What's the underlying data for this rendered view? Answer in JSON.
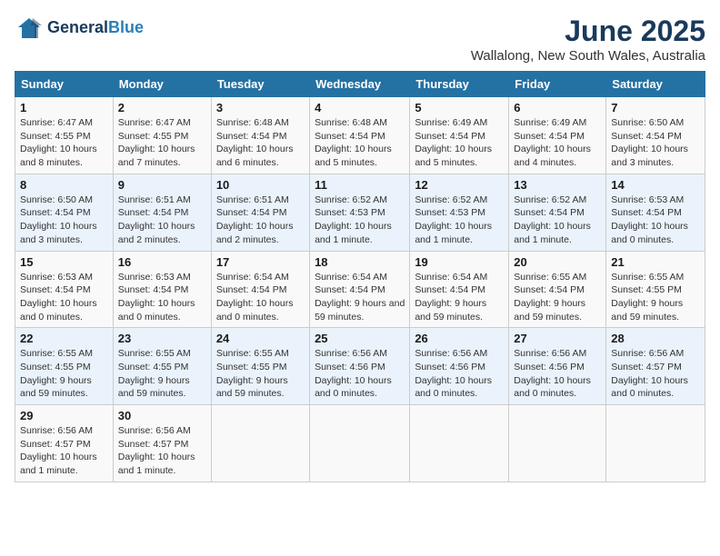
{
  "header": {
    "logo_text_general": "General",
    "logo_text_blue": "Blue",
    "title": "June 2025",
    "subtitle": "Wallalong, New South Wales, Australia"
  },
  "calendar": {
    "headers": [
      "Sunday",
      "Monday",
      "Tuesday",
      "Wednesday",
      "Thursday",
      "Friday",
      "Saturday"
    ],
    "weeks": [
      [
        {
          "day": "",
          "detail": ""
        },
        {
          "day": "2",
          "detail": "Sunrise: 6:47 AM\nSunset: 4:55 PM\nDaylight: 10 hours and 7 minutes."
        },
        {
          "day": "3",
          "detail": "Sunrise: 6:48 AM\nSunset: 4:54 PM\nDaylight: 10 hours and 6 minutes."
        },
        {
          "day": "4",
          "detail": "Sunrise: 6:48 AM\nSunset: 4:54 PM\nDaylight: 10 hours and 5 minutes."
        },
        {
          "day": "5",
          "detail": "Sunrise: 6:49 AM\nSunset: 4:54 PM\nDaylight: 10 hours and 5 minutes."
        },
        {
          "day": "6",
          "detail": "Sunrise: 6:49 AM\nSunset: 4:54 PM\nDaylight: 10 hours and 4 minutes."
        },
        {
          "day": "7",
          "detail": "Sunrise: 6:50 AM\nSunset: 4:54 PM\nDaylight: 10 hours and 3 minutes."
        }
      ],
      [
        {
          "day": "1",
          "detail": "Sunrise: 6:47 AM\nSunset: 4:55 PM\nDaylight: 10 hours and 8 minutes."
        },
        {
          "day": "8",
          "detail": ""
        },
        {
          "day": "",
          "detail": ""
        },
        {
          "day": "",
          "detail": ""
        },
        {
          "day": "",
          "detail": ""
        },
        {
          "day": "",
          "detail": ""
        },
        {
          "day": "",
          "detail": ""
        }
      ],
      [
        {
          "day": "8",
          "detail": "Sunrise: 6:50 AM\nSunset: 4:54 PM\nDaylight: 10 hours and 3 minutes."
        },
        {
          "day": "9",
          "detail": "Sunrise: 6:51 AM\nSunset: 4:54 PM\nDaylight: 10 hours and 2 minutes."
        },
        {
          "day": "10",
          "detail": "Sunrise: 6:51 AM\nSunset: 4:54 PM\nDaylight: 10 hours and 2 minutes."
        },
        {
          "day": "11",
          "detail": "Sunrise: 6:52 AM\nSunset: 4:53 PM\nDaylight: 10 hours and 1 minute."
        },
        {
          "day": "12",
          "detail": "Sunrise: 6:52 AM\nSunset: 4:53 PM\nDaylight: 10 hours and 1 minute."
        },
        {
          "day": "13",
          "detail": "Sunrise: 6:52 AM\nSunset: 4:54 PM\nDaylight: 10 hours and 1 minute."
        },
        {
          "day": "14",
          "detail": "Sunrise: 6:53 AM\nSunset: 4:54 PM\nDaylight: 10 hours and 0 minutes."
        }
      ],
      [
        {
          "day": "15",
          "detail": "Sunrise: 6:53 AM\nSunset: 4:54 PM\nDaylight: 10 hours and 0 minutes."
        },
        {
          "day": "16",
          "detail": "Sunrise: 6:53 AM\nSunset: 4:54 PM\nDaylight: 10 hours and 0 minutes."
        },
        {
          "day": "17",
          "detail": "Sunrise: 6:54 AM\nSunset: 4:54 PM\nDaylight: 10 hours and 0 minutes."
        },
        {
          "day": "18",
          "detail": "Sunrise: 6:54 AM\nSunset: 4:54 PM\nDaylight: 9 hours and 59 minutes."
        },
        {
          "day": "19",
          "detail": "Sunrise: 6:54 AM\nSunset: 4:54 PM\nDaylight: 9 hours and 59 minutes."
        },
        {
          "day": "20",
          "detail": "Sunrise: 6:55 AM\nSunset: 4:54 PM\nDaylight: 9 hours and 59 minutes."
        },
        {
          "day": "21",
          "detail": "Sunrise: 6:55 AM\nSunset: 4:55 PM\nDaylight: 9 hours and 59 minutes."
        }
      ],
      [
        {
          "day": "22",
          "detail": "Sunrise: 6:55 AM\nSunset: 4:55 PM\nDaylight: 9 hours and 59 minutes."
        },
        {
          "day": "23",
          "detail": "Sunrise: 6:55 AM\nSunset: 4:55 PM\nDaylight: 9 hours and 59 minutes."
        },
        {
          "day": "24",
          "detail": "Sunrise: 6:55 AM\nSunset: 4:55 PM\nDaylight: 9 hours and 59 minutes."
        },
        {
          "day": "25",
          "detail": "Sunrise: 6:56 AM\nSunset: 4:56 PM\nDaylight: 10 hours and 0 minutes."
        },
        {
          "day": "26",
          "detail": "Sunrise: 6:56 AM\nSunset: 4:56 PM\nDaylight: 10 hours and 0 minutes."
        },
        {
          "day": "27",
          "detail": "Sunrise: 6:56 AM\nSunset: 4:56 PM\nDaylight: 10 hours and 0 minutes."
        },
        {
          "day": "28",
          "detail": "Sunrise: 6:56 AM\nSunset: 4:57 PM\nDaylight: 10 hours and 0 minutes."
        }
      ],
      [
        {
          "day": "29",
          "detail": "Sunrise: 6:56 AM\nSunset: 4:57 PM\nDaylight: 10 hours and 1 minute."
        },
        {
          "day": "30",
          "detail": "Sunrise: 6:56 AM\nSunset: 4:57 PM\nDaylight: 10 hours and 1 minute."
        },
        {
          "day": "",
          "detail": ""
        },
        {
          "day": "",
          "detail": ""
        },
        {
          "day": "",
          "detail": ""
        },
        {
          "day": "",
          "detail": ""
        },
        {
          "day": "",
          "detail": ""
        }
      ]
    ]
  }
}
